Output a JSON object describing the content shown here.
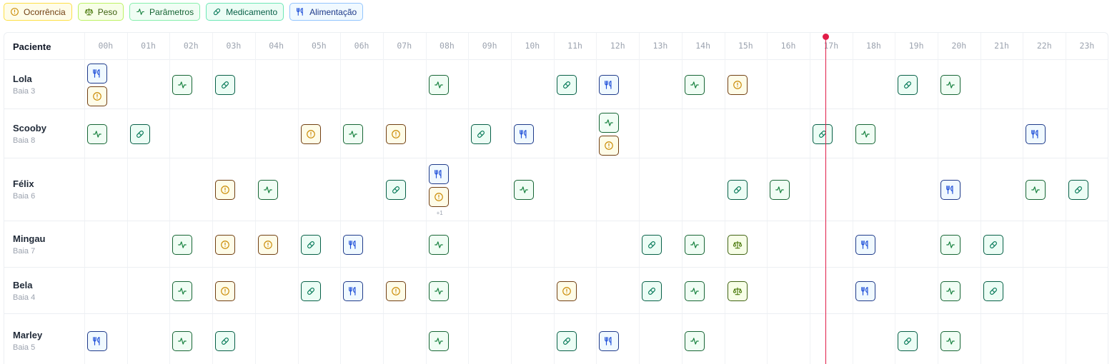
{
  "legend": [
    {
      "type": "occ",
      "label": "Ocorrência",
      "icon": "alert-circle-icon"
    },
    {
      "type": "peso",
      "label": "Peso",
      "icon": "scale-icon"
    },
    {
      "type": "par",
      "label": "Parâmetros",
      "icon": "activity-icon"
    },
    {
      "type": "med",
      "label": "Medicamento",
      "icon": "pill-icon"
    },
    {
      "type": "ali",
      "label": "Alimentação",
      "icon": "utensils-icon"
    }
  ],
  "header": {
    "patient_col": "Paciente"
  },
  "hours": [
    "00h",
    "01h",
    "02h",
    "03h",
    "04h",
    "05h",
    "06h",
    "07h",
    "08h",
    "09h",
    "10h",
    "11h",
    "12h",
    "13h",
    "14h",
    "15h",
    "16h",
    "17h",
    "18h",
    "19h",
    "20h",
    "21h",
    "22h",
    "23h"
  ],
  "colors": {
    "now_line": "#e11d48",
    "occ": "#ca8a04",
    "peso": "#4d7c0f",
    "par": "#15803d",
    "med": "#047857",
    "ali": "#1d4ed8"
  },
  "rows": [
    {
      "name": "Lola",
      "baia": "Baia 3",
      "events": [
        {
          "h": 0,
          "types": [
            "ali",
            "occ"
          ]
        },
        {
          "h": 2,
          "types": [
            "par"
          ]
        },
        {
          "h": 3,
          "types": [
            "med"
          ]
        },
        {
          "h": 8,
          "types": [
            "par"
          ]
        },
        {
          "h": 11,
          "types": [
            "med"
          ]
        },
        {
          "h": 12,
          "types": [
            "ali"
          ]
        },
        {
          "h": 14,
          "types": [
            "par"
          ]
        },
        {
          "h": 15,
          "types": [
            "occ"
          ]
        },
        {
          "h": 19,
          "types": [
            "med"
          ]
        },
        {
          "h": 20,
          "types": [
            "par"
          ]
        }
      ]
    },
    {
      "name": "Scooby",
      "baia": "Baia 8",
      "events": [
        {
          "h": 0,
          "types": [
            "par"
          ]
        },
        {
          "h": 1,
          "types": [
            "med"
          ]
        },
        {
          "h": 5,
          "types": [
            "occ"
          ]
        },
        {
          "h": 6,
          "types": [
            "par"
          ]
        },
        {
          "h": 7,
          "types": [
            "occ"
          ]
        },
        {
          "h": 9,
          "types": [
            "med"
          ]
        },
        {
          "h": 10,
          "types": [
            "ali"
          ]
        },
        {
          "h": 12,
          "types": [
            "par",
            "occ"
          ]
        },
        {
          "h": 17,
          "types": [
            "med"
          ]
        },
        {
          "h": 18,
          "types": [
            "par"
          ]
        },
        {
          "h": 22,
          "types": [
            "ali"
          ]
        }
      ]
    },
    {
      "name": "Félix",
      "baia": "Baia 6",
      "events": [
        {
          "h": 3,
          "types": [
            "occ"
          ]
        },
        {
          "h": 4,
          "types": [
            "par"
          ]
        },
        {
          "h": 7,
          "types": [
            "med"
          ]
        },
        {
          "h": 8,
          "types": [
            "ali",
            "occ"
          ],
          "more": "+1"
        },
        {
          "h": 10,
          "types": [
            "par"
          ]
        },
        {
          "h": 15,
          "types": [
            "med"
          ]
        },
        {
          "h": 16,
          "types": [
            "par"
          ]
        },
        {
          "h": 20,
          "types": [
            "ali"
          ]
        },
        {
          "h": 22,
          "types": [
            "par"
          ]
        },
        {
          "h": 23,
          "types": [
            "med"
          ]
        }
      ]
    },
    {
      "name": "Mingau",
      "baia": "Baia 7",
      "events": [
        {
          "h": 2,
          "types": [
            "par"
          ]
        },
        {
          "h": 3,
          "types": [
            "occ"
          ]
        },
        {
          "h": 4,
          "types": [
            "occ"
          ]
        },
        {
          "h": 5,
          "types": [
            "med"
          ]
        },
        {
          "h": 6,
          "types": [
            "ali"
          ]
        },
        {
          "h": 8,
          "types": [
            "par"
          ]
        },
        {
          "h": 13,
          "types": [
            "med"
          ]
        },
        {
          "h": 14,
          "types": [
            "par"
          ]
        },
        {
          "h": 15,
          "types": [
            "peso"
          ]
        },
        {
          "h": 18,
          "types": [
            "ali"
          ]
        },
        {
          "h": 20,
          "types": [
            "par"
          ]
        },
        {
          "h": 21,
          "types": [
            "med"
          ]
        }
      ]
    },
    {
      "name": "Bela",
      "baia": "Baia 4",
      "events": [
        {
          "h": 2,
          "types": [
            "par"
          ]
        },
        {
          "h": 3,
          "types": [
            "occ"
          ]
        },
        {
          "h": 5,
          "types": [
            "med"
          ]
        },
        {
          "h": 6,
          "types": [
            "ali"
          ]
        },
        {
          "h": 7,
          "types": [
            "occ"
          ]
        },
        {
          "h": 8,
          "types": [
            "par"
          ]
        },
        {
          "h": 11,
          "types": [
            "occ"
          ]
        },
        {
          "h": 13,
          "types": [
            "med"
          ]
        },
        {
          "h": 14,
          "types": [
            "par"
          ]
        },
        {
          "h": 15,
          "types": [
            "peso"
          ]
        },
        {
          "h": 18,
          "types": [
            "ali"
          ]
        },
        {
          "h": 20,
          "types": [
            "par"
          ]
        },
        {
          "h": 21,
          "types": [
            "med"
          ]
        }
      ]
    },
    {
      "name": "Marley",
      "baia": "Baia 5",
      "events": [
        {
          "h": 0,
          "types": [
            "ali"
          ]
        },
        {
          "h": 2,
          "types": [
            "par"
          ]
        },
        {
          "h": 3,
          "types": [
            "med"
          ]
        },
        {
          "h": 8,
          "types": [
            "par"
          ]
        },
        {
          "h": 11,
          "types": [
            "med"
          ]
        },
        {
          "h": 12,
          "types": [
            "ali"
          ]
        },
        {
          "h": 14,
          "types": [
            "par"
          ]
        },
        {
          "h": 19,
          "types": [
            "med"
          ]
        },
        {
          "h": 20,
          "types": [
            "par"
          ]
        }
      ]
    }
  ]
}
